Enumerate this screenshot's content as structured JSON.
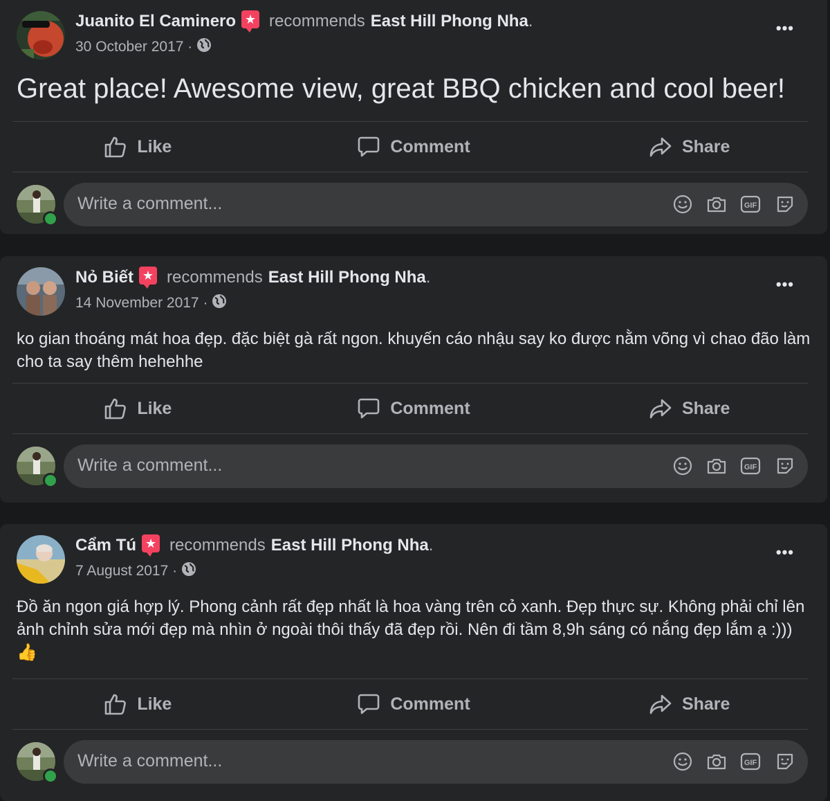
{
  "posts": [
    {
      "author": "Juanito El Caminero",
      "verb": "recommends",
      "page": "East Hill Phong Nha",
      "date": "30 October 2017 ·",
      "text": "Great place! Awesome view, great BBQ chicken and cool beer!"
    },
    {
      "author": "Nỏ Biết",
      "verb": "recommends",
      "page": "East Hill Phong Nha",
      "date": "14 November 2017 ·",
      "text": "ko gian thoáng mát hoa đẹp. đặc biệt gà rất ngon. khuyến cáo nhậu say ko được nằm võng vì chao đão làm cho ta say thêm hehehhe"
    },
    {
      "author": "Cẩm Tú",
      "verb": "recommends",
      "page": "East Hill Phong Nha",
      "date": "7 August 2017 ·",
      "text": "Đồ ăn ngon giá hợp lý. Phong cảnh rất đẹp nhất là hoa vàng trên cỏ xanh. Đẹp thực sự. Không phải chỉ lên ảnh chỉnh sửa mới đẹp mà nhìn ở ngoài thôi thấy đã đẹp rồi. Nên đi tầm 8,9h sáng có nắng đẹp lắm ạ :))) 👍"
    }
  ],
  "actions": {
    "like": "Like",
    "comment": "Comment",
    "share": "Share"
  },
  "composer": {
    "placeholder": "Write a comment..."
  },
  "more_label": "•••",
  "punctuation_end": ".",
  "icons": [
    "recommendation-badge-icon",
    "globe-icon",
    "more-options-icon",
    "like-icon",
    "comment-icon",
    "share-icon",
    "emoji-icon",
    "camera-icon",
    "gif-icon",
    "sticker-icon"
  ],
  "colors": {
    "background": "#18191a",
    "card": "#242526",
    "text": "#e4e6eb",
    "secondary": "#b0b3b8",
    "badge": "#f3425f",
    "online": "#31a24c",
    "input": "#3a3b3c"
  }
}
